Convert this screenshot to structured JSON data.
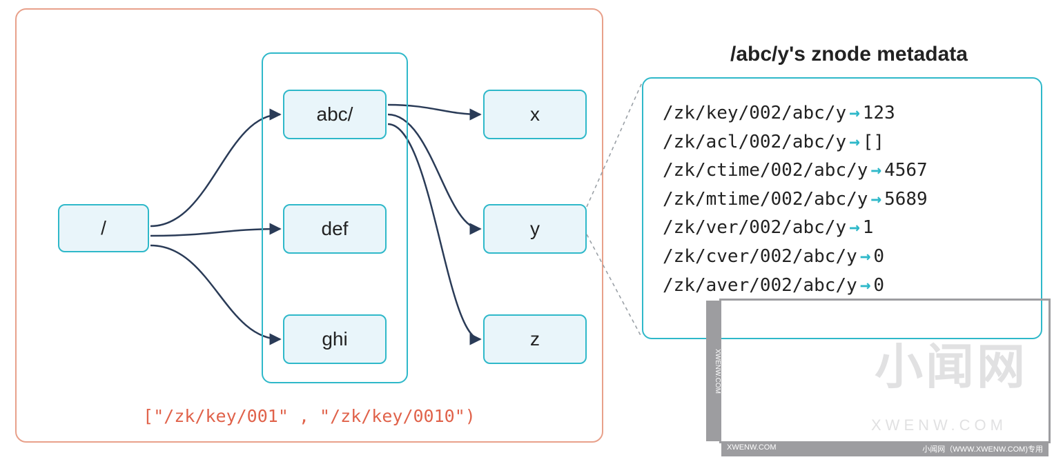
{
  "tree": {
    "root": "/",
    "level1": [
      "abc/",
      "def",
      "ghi"
    ],
    "level2": [
      "x",
      "y",
      "z"
    ],
    "range_caption": "[\"/zk/key/001\" , \"/zk/key/0010\")"
  },
  "metadata": {
    "title": "/abc/y's znode metadata",
    "lines": [
      {
        "key": "/zk/key/002/abc/y",
        "value": "123"
      },
      {
        "key": "/zk/acl/002/abc/y",
        "value": "[]"
      },
      {
        "key": "/zk/ctime/002/abc/y",
        "value": "4567"
      },
      {
        "key": "/zk/mtime/002/abc/y",
        "value": "5689"
      },
      {
        "key": "/zk/ver/002/abc/y",
        "value": "1"
      },
      {
        "key": "/zk/cver/002/abc/y",
        "value": "0"
      },
      {
        "key": "/zk/aver/002/abc/y",
        "value": "0"
      }
    ]
  },
  "watermark": {
    "tab": "XWENW.COM",
    "bottom_left": "XWENW.COM",
    "bottom_right": "小闻网（WWW.XWENW.COM)专用",
    "big": "小闻网",
    "sub": "XWENW.COM"
  },
  "colors": {
    "node_border": "#2eb8c9",
    "node_fill": "#e9f5fa",
    "outer_border": "#e8a08a",
    "caption": "#e0624a",
    "arrow": "#2a3b57"
  }
}
